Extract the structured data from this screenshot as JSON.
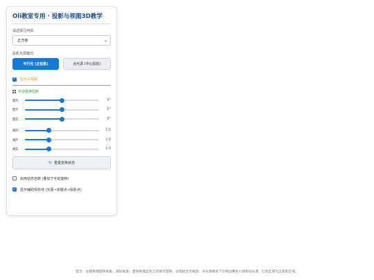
{
  "panel": {
    "title": "Oli教室专用 · 投影与视图3D教学",
    "shape_label": "请选择几何体:",
    "shape_selected": "正方体",
    "projection_label": "投影光源模式:",
    "modes": [
      {
        "label": "平行光 (正投影)",
        "active": true
      },
      {
        "label": "点光源 (中心投影)",
        "active": false
      }
    ],
    "show_three_views": {
      "label": "显示三视图",
      "checked": true
    },
    "manual_section": "手动变换控制",
    "sliders": [
      {
        "label": "旋X:",
        "value": "0°",
        "level": 0.5
      },
      {
        "label": "旋Y:",
        "value": "0°",
        "level": 0.5
      },
      {
        "label": "旋Z:",
        "value": "0°",
        "level": 0.5
      },
      {
        "label": "缩X:",
        "value": "1.0",
        "level": 0.32
      },
      {
        "label": "缩Y:",
        "value": "1.0",
        "level": 0.32
      },
      {
        "label": "缩Z:",
        "value": "1.0",
        "level": 0.32
      }
    ],
    "reset_label": "重置变换状态",
    "auto_rotate": {
      "label": "启用动态自转 (叠加于手动旋转)",
      "checked": false
    },
    "show_aux_lines": {
      "label": "显示辅助投影线 (光源→关键点→投影点)",
      "checked": true
    }
  },
  "hint": "提示：左键拖拽旋转视角，滚轮缩放；直接拖拽蓝色几何体可旋转，双指捏合可缩放；点光源模式下可拖动黄色小球移动光源。红色区域为正投影区域。",
  "colors": {
    "accent": "#1778d6",
    "title": "#1e4f8c",
    "orange": "#e8901a",
    "green": "#3a9a3a"
  },
  "icons": {
    "section": "grid-icon",
    "reset": "refresh-icon",
    "select": "chevron-down-icon"
  }
}
